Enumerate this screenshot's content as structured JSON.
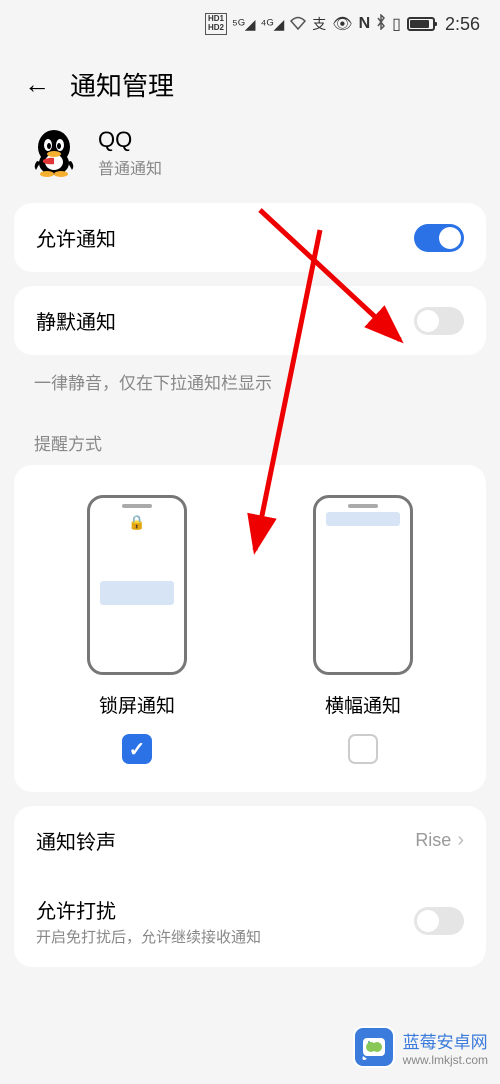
{
  "status": {
    "time": "2:56"
  },
  "header": {
    "title": "通知管理"
  },
  "app": {
    "name": "QQ",
    "subtitle": "普通通知"
  },
  "settings": {
    "allow_notify": {
      "label": "允许通知",
      "on": true
    },
    "silent": {
      "label": "静默通知",
      "on": false
    },
    "silent_desc": "一律静音，仅在下拉通知栏显示"
  },
  "style_section": {
    "label": "提醒方式",
    "lock_label": "锁屏通知",
    "lock_checked": true,
    "banner_label": "横幅通知",
    "banner_checked": false
  },
  "sound": {
    "label": "通知铃声",
    "value": "Rise"
  },
  "disturb": {
    "label": "允许打扰",
    "sub": "开启免打扰后，允许继续接收通知",
    "on": false
  },
  "watermark": {
    "name": "蓝莓安卓网",
    "url": "www.lmkjst.com"
  }
}
